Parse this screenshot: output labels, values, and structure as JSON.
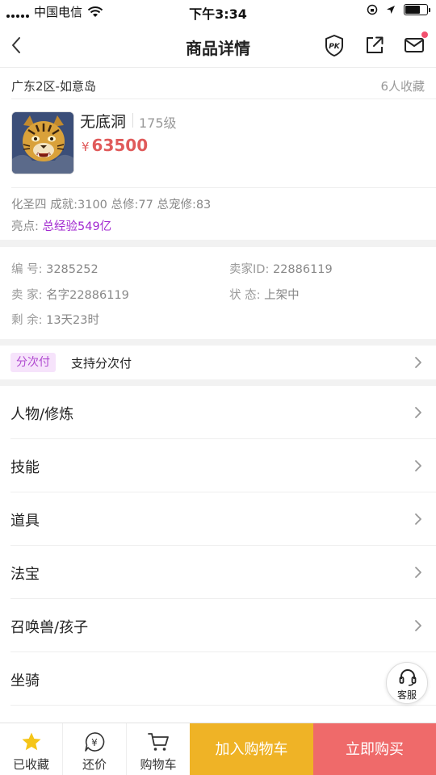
{
  "status_bar": {
    "carrier": "中国电信",
    "time": "下午3:34",
    "battery_level": 0.7
  },
  "nav": {
    "title": "商品详情",
    "icons": [
      "back-icon",
      "pk-icon",
      "share-icon",
      "mail-icon"
    ]
  },
  "goods": {
    "server": "广东2区-如意岛",
    "favorites": "6人收藏",
    "name": "无底洞",
    "level": "175级",
    "currency": "¥",
    "price": "63500",
    "attributes": "化圣四 成就:3100 总修:77 总宠修:83",
    "highlight_label": "亮点:",
    "highlight_value": "总经验549亿"
  },
  "info": {
    "id_label": "编  号:",
    "id_value": "3285252",
    "seller_id_label": "卖家ID:",
    "seller_id_value": "22886119",
    "seller_label": "卖  家:",
    "seller_value": "名字22886119",
    "status_label": "状  态:",
    "status_value": "上架中",
    "remaining_label": "剩  余:",
    "remaining_value": "13天23时"
  },
  "installment": {
    "badge": "分次付",
    "text": "支持分次付"
  },
  "menu": {
    "items": [
      {
        "label": "人物/修炼"
      },
      {
        "label": "技能"
      },
      {
        "label": "道具"
      },
      {
        "label": "法宝"
      },
      {
        "label": "召唤兽/孩子"
      },
      {
        "label": "坐骑"
      }
    ]
  },
  "service": {
    "label": "客服"
  },
  "bottom": {
    "favorited_label": "已收藏",
    "bargain_label": "还价",
    "cart_label": "购物车",
    "add_to_cart": "加入购物车",
    "buy_now": "立即购买"
  },
  "colors": {
    "price": "#e05a5a",
    "highlight": "#a22ad0",
    "add_to_cart_bg": "#efb326",
    "buy_now_bg": "#ef6a6a",
    "star": "#f5c518"
  }
}
